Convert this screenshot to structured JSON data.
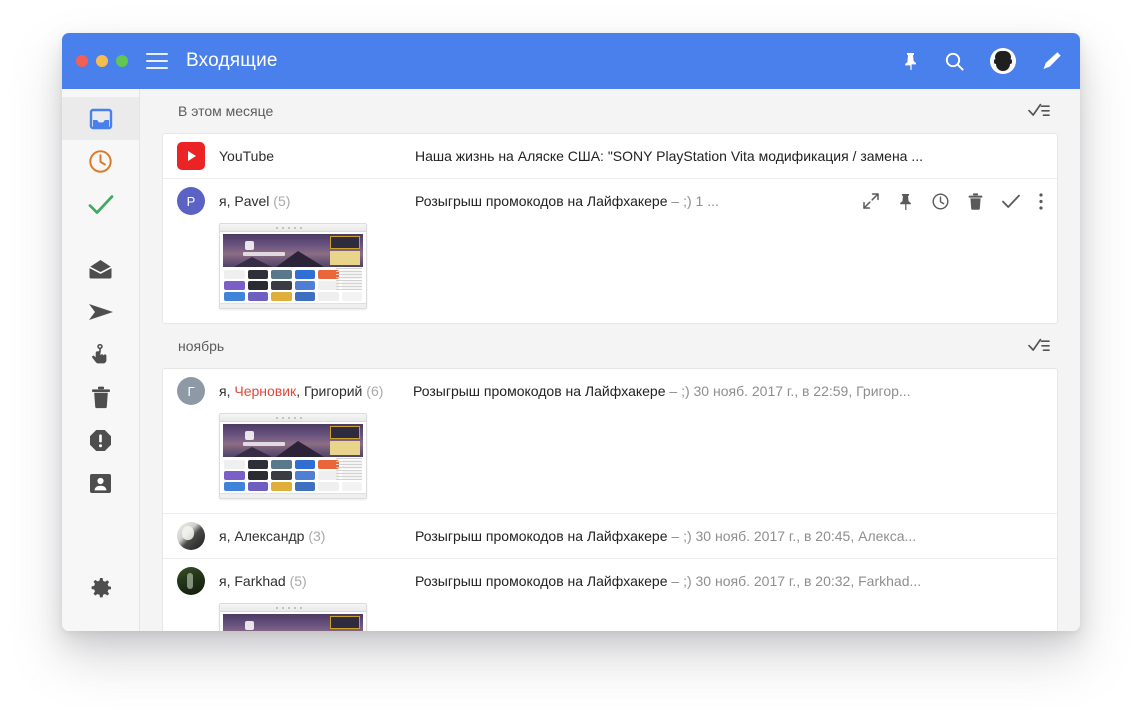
{
  "window": {
    "title": "Входящие",
    "accent_color": "#4a80eb",
    "traffic_lights": [
      "close",
      "minimize",
      "zoom"
    ]
  },
  "titlebar": {
    "menu_icon": "hamburger-icon",
    "actions": [
      {
        "name": "pin-icon",
        "label": "Закрепить"
      },
      {
        "name": "search-icon",
        "label": "Поиск"
      },
      {
        "name": "account-avatar",
        "label": "Аккаунт"
      },
      {
        "name": "compose-pencil-icon",
        "label": "Написать"
      }
    ]
  },
  "sidebar": {
    "items": [
      {
        "name": "sidebar-item-inbox",
        "icon": "inbox-icon",
        "color": "#4a80eb",
        "active": true
      },
      {
        "name": "sidebar-item-snoozed",
        "icon": "clock-icon",
        "color": "#d97b2b",
        "active": false
      },
      {
        "name": "sidebar-item-done",
        "icon": "check-icon",
        "color": "#3fa861",
        "active": false
      },
      {
        "name": "sidebar-item-drafts",
        "icon": "open-envelope-icon",
        "color": "#4e4e4e",
        "active": false
      },
      {
        "name": "sidebar-item-sent",
        "icon": "send-icon",
        "color": "#4e4e4e",
        "active": false
      },
      {
        "name": "sidebar-item-reminders",
        "icon": "hand-string-icon",
        "color": "#4e4e4e",
        "active": false
      },
      {
        "name": "sidebar-item-trash",
        "icon": "trash-icon",
        "color": "#4e4e4e",
        "active": false
      },
      {
        "name": "sidebar-item-spam",
        "icon": "warning-octagon-icon",
        "color": "#4e4e4e",
        "active": false
      },
      {
        "name": "sidebar-item-contacts",
        "icon": "contact-card-icon",
        "color": "#4e4e4e",
        "active": false
      }
    ],
    "settings": {
      "name": "sidebar-item-settings",
      "icon": "gear-icon",
      "color": "#4e4e4e"
    }
  },
  "list": {
    "groups": [
      {
        "title": "В этом месяце",
        "mark_read_icon": "mark-all-read-icon",
        "rows": [
          {
            "avatar": {
              "type": "youtube",
              "letter": "",
              "bg": "#ec2324"
            },
            "sender": "YouTube",
            "count": "",
            "draft_label": "",
            "subject": "Наша жизнь на Аляске США: \"SONY PlayStation Vita модификация / замена ...",
            "snippet": "",
            "has_thumbnail": false,
            "hover_actions": []
          },
          {
            "avatar": {
              "type": "letter",
              "letter": "P",
              "bg": "#5a62c4"
            },
            "sender": "я, Pavel",
            "count": "(5)",
            "draft_label": "",
            "subject": "Розыгрыш промокодов на Лайфхакере",
            "snippet": " – ;) 1 ...",
            "has_thumbnail": true,
            "hover_actions": [
              {
                "name": "expand-icon"
              },
              {
                "name": "pin-icon"
              },
              {
                "name": "snooze-clock-icon"
              },
              {
                "name": "trash-icon"
              },
              {
                "name": "done-check-icon"
              },
              {
                "name": "more-menu-icon"
              }
            ]
          }
        ]
      },
      {
        "title": "ноябрь",
        "mark_read_icon": "mark-all-read-icon",
        "rows": [
          {
            "avatar": {
              "type": "letter",
              "letter": "Г",
              "bg": "#8d9aa6"
            },
            "sender_prefix": "я, ",
            "draft_label": "Черновик",
            "sender_suffix": ", Григорий",
            "count": "(6)",
            "subject": "Розыгрыш промокодов на Лайфхакере",
            "snippet": " – ;) 30 нояб. 2017 г., в 22:59, Григор...",
            "has_thumbnail": true,
            "hover_actions": []
          },
          {
            "avatar": {
              "type": "photo-bw",
              "letter": "",
              "bg": "#cccccc"
            },
            "sender": "я, Александр",
            "count": "(3)",
            "draft_label": "",
            "subject": "Розыгрыш промокодов на Лайфхакере",
            "snippet": " – ;) 30 нояб. 2017 г., в 20:45, Алекса...",
            "has_thumbnail": false,
            "hover_actions": []
          },
          {
            "avatar": {
              "type": "photo-green",
              "letter": "",
              "bg": "#30421f"
            },
            "sender": "я, Farkhad",
            "count": "(5)",
            "draft_label": "",
            "subject": "Розыгрыш промокодов на Лайфхакере",
            "snippet": " – ;) 30 нояб. 2017 г., в 20:32, Farkhad...",
            "has_thumbnail": true,
            "hover_actions": []
          }
        ]
      }
    ]
  },
  "colors": {
    "accent": "#4a80eb",
    "draft_red": "#e0473b",
    "snoozed_orange": "#d97b2b",
    "done_green": "#3fa861",
    "youtube_red": "#ec2324"
  }
}
